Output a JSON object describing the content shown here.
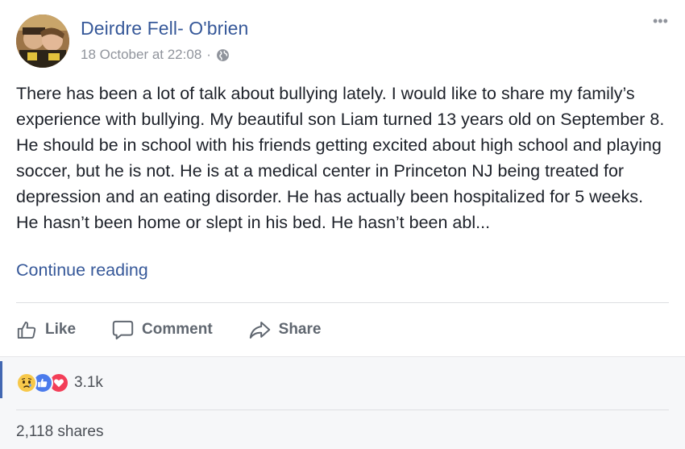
{
  "post": {
    "author": "Deirdre Fell- O'brien",
    "timestamp": "18 October at 22:08",
    "separator": "·",
    "privacy_icon": "globe-icon",
    "more_icon": "•••",
    "body": "There has been a lot of talk about bullying lately. I would like to share my family’s experience with bullying. My beautiful son Liam turned 13 years old on September 8. He should be in school with his friends getting excited about high school and playing soccer, but he is not. He is at a medical center in Princeton NJ being treated for depression and an eating disorder. He has actually been hospitalized for 5 weeks. He hasn’t been home or slept in his bed. He hasn’t been abl...",
    "continue_label": "Continue reading"
  },
  "actions": {
    "like_label": "Like",
    "comment_label": "Comment",
    "share_label": "Share"
  },
  "stats": {
    "reactions": [
      "sad",
      "like",
      "love"
    ],
    "reaction_count": "3.1k",
    "shares": "2,118 shares"
  },
  "colors": {
    "link": "#365899",
    "meta": "#90949c",
    "action": "#606770",
    "footer_bg": "#f6f7f9",
    "like_blue": "#4b7bec",
    "love_red": "#f33e58",
    "sad_yellow": "#f7c84a"
  }
}
